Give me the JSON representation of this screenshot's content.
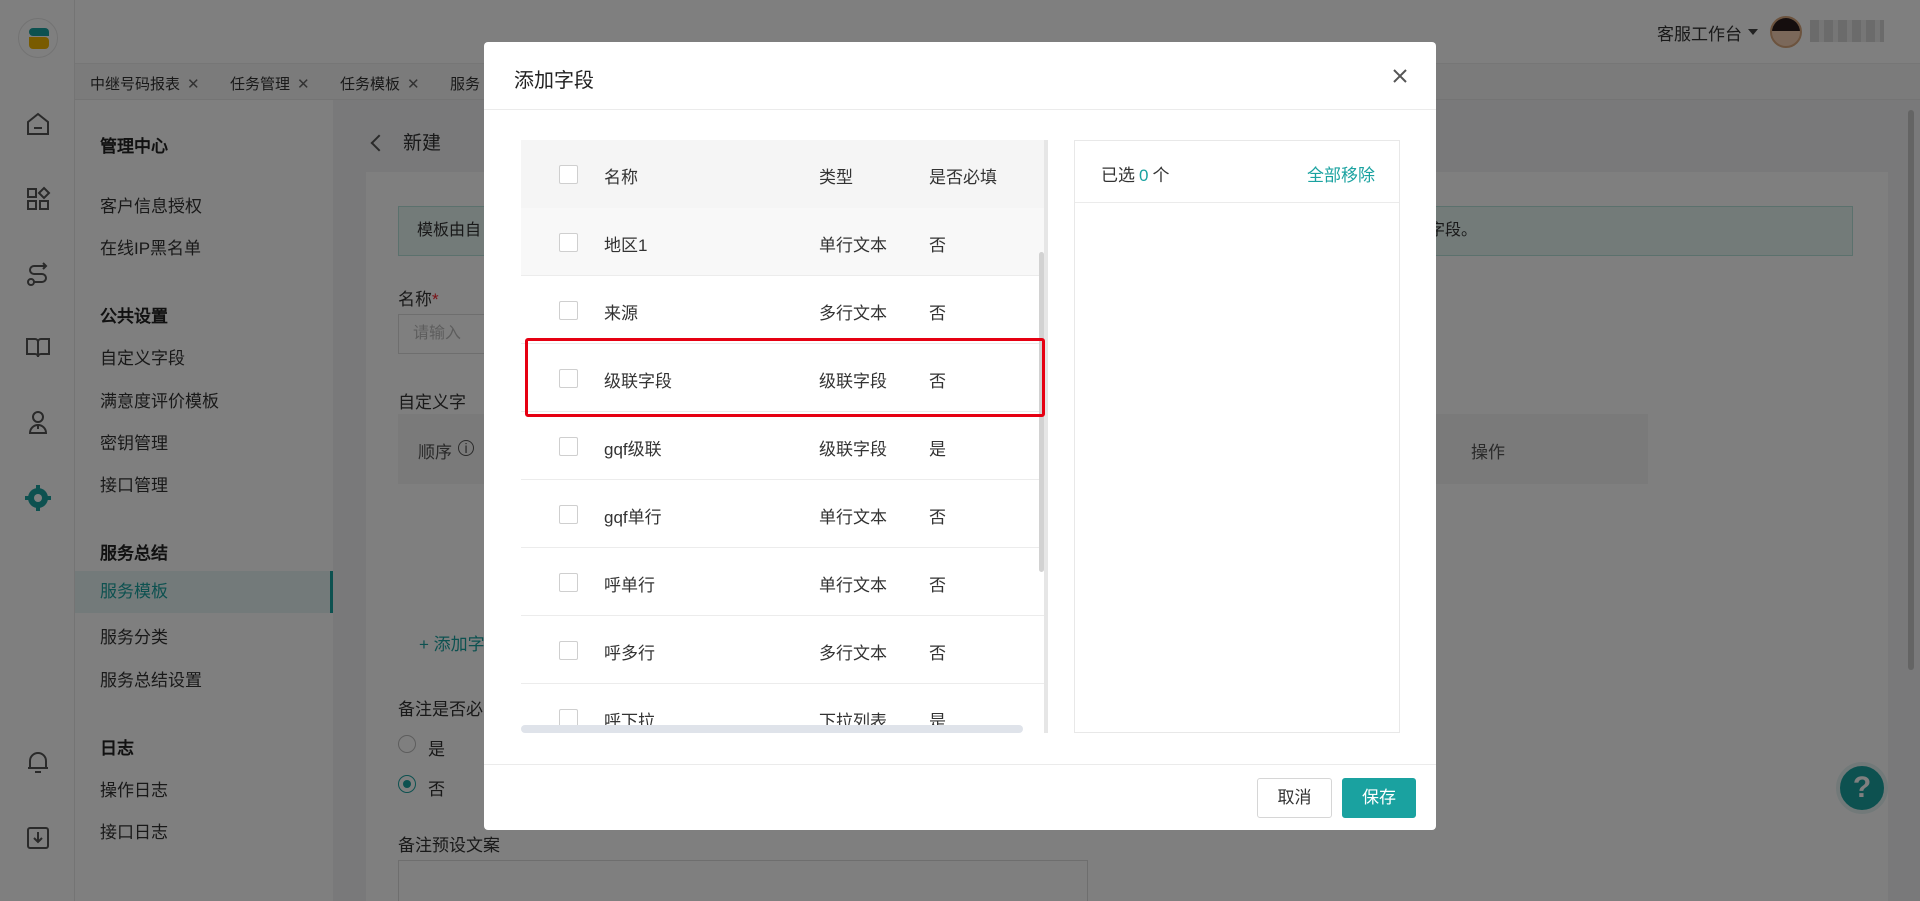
{
  "topbar": {
    "workspace": "客服工作台"
  },
  "tabs": [
    {
      "label": "中继号码报表"
    },
    {
      "label": "任务管理"
    },
    {
      "label": "任务模板"
    },
    {
      "label": "服务"
    }
  ],
  "sidemenu": {
    "title": "管理中心",
    "items_top": [
      "客户信息授权",
      "在线IP黑名单"
    ],
    "group_public": "公共设置",
    "items_public": [
      "自定义字段",
      "满意度评价模板",
      "密钥管理",
      "接口管理"
    ],
    "group_service": "服务总结",
    "items_service": [
      "服务模板",
      "服务分类",
      "服务总结设置"
    ],
    "group_log": "日志",
    "items_log": [
      "操作日志",
      "接口日志"
    ]
  },
  "page": {
    "back_title": "新建",
    "info_text": "模板由自",
    "info_tail": "字段。",
    "name_label": "名称",
    "required_mark": "*",
    "name_placeholder": "请输入",
    "custom_fields_label": "自定义字",
    "col_order": "顺序",
    "col_action": "操作",
    "add_field": "+ 添加字",
    "remark_required_label": "备注是否必",
    "opt_yes": "是",
    "opt_no": "否",
    "remark_preset_label": "备注预设文案"
  },
  "modal": {
    "title": "添加字段",
    "columns": {
      "name": "名称",
      "type": "类型",
      "required": "是否必填"
    },
    "rows": [
      {
        "name": "地区1",
        "type": "单行文本",
        "required": "否"
      },
      {
        "name": "来源",
        "type": "多行文本",
        "required": "否"
      },
      {
        "name": "级联字段",
        "type": "级联字段",
        "required": "否"
      },
      {
        "name": "gqf级联",
        "type": "级联字段",
        "required": "是"
      },
      {
        "name": "gqf单行",
        "type": "单行文本",
        "required": "否"
      },
      {
        "name": "呼单行",
        "type": "单行文本",
        "required": "否"
      },
      {
        "name": "呼多行",
        "type": "多行文本",
        "required": "否"
      },
      {
        "name": "呼下拉",
        "type": "下拉列表",
        "required": "是"
      }
    ],
    "selected_prefix": "已选",
    "selected_count": "0",
    "selected_suffix": "个",
    "remove_all": "全部移除",
    "cancel": "取消",
    "save": "保存"
  },
  "colors": {
    "accent": "#1aa2a0",
    "highlight": "#e60012"
  },
  "icons": [
    "home-icon",
    "apps-icon",
    "route-icon",
    "book-icon",
    "agent-icon",
    "settings-icon",
    "bell-icon",
    "download-icon",
    "close-icon",
    "info-icon",
    "help-icon"
  ]
}
